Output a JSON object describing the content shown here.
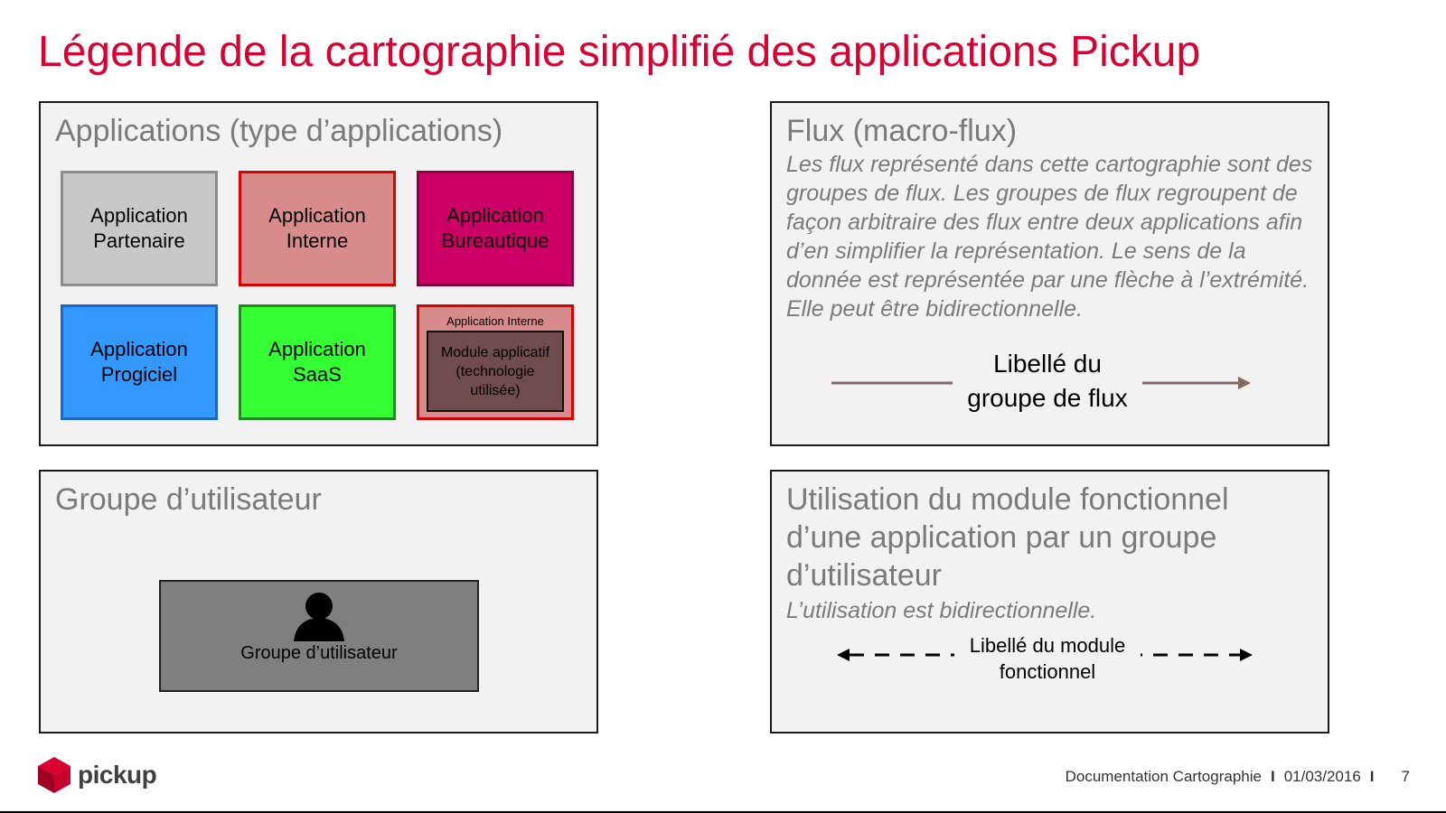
{
  "title": "Légende de la cartographie simplifié des applications Pickup",
  "applications": {
    "heading": "Applications (type d’applications)",
    "items": [
      {
        "line1": "Application",
        "line2": "Partenaire",
        "fill": "#c8c8c8",
        "border": "#8c8c8c"
      },
      {
        "line1": "Application",
        "line2": "Interne",
        "fill": "#d78b8b",
        "border": "#d90000"
      },
      {
        "line1": "Application",
        "line2": "Bureautique",
        "fill": "#cc0066",
        "border": "#8c0040"
      },
      {
        "line1": "Application",
        "line2": "Progiciel",
        "fill": "#3399ff",
        "border": "#1a66cc"
      },
      {
        "line1": "Application",
        "line2": "SaaS",
        "fill": "#33ff33",
        "border": "#1a8c1a"
      }
    ],
    "internal_with_module": {
      "caption": "Application Interne",
      "module": "Module applicatif (technologie utilisée)",
      "fill": "#d78b8b",
      "border": "#d90000"
    }
  },
  "flux": {
    "heading": "Flux (macro-flux)",
    "description": "Les flux représenté dans cette cartographie sont des groupes de flux. Les groupes de flux regroupent de façon arbitraire des flux entre deux applications afin d’en simplifier la représentation. Le sens de la donnée est représentée par une flèche à l’extrémité. Elle peut être bidirectionnelle.",
    "arrow_label": "Libellé du groupe de flux"
  },
  "user_group": {
    "heading": "Groupe d’utilisateur",
    "box_label": "Groupe d’utilisateur"
  },
  "usage": {
    "heading": "Utilisation du module fonctionnel d’une application par un groupe d’utilisateur",
    "description": "L’utilisation est bidirectionnelle.",
    "arrow_label": "Libellé du module fonctionnel"
  },
  "footer": {
    "logo_text": "pickup",
    "doc_title": "Documentation Cartographie",
    "date": "01/03/2016",
    "page": "7"
  },
  "colors": {
    "brand": "#dc0032",
    "panel_bg": "#f2f2f2",
    "heading_gray": "#7a7a7a",
    "flux_arrow": "#7f6b62"
  }
}
